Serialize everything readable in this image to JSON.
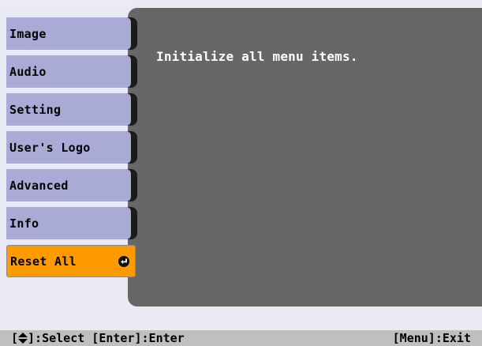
{
  "menu": {
    "items": [
      {
        "label": "Image",
        "active": false
      },
      {
        "label": "Audio",
        "active": false
      },
      {
        "label": "Setting",
        "active": false
      },
      {
        "label": "User's Logo",
        "active": false
      },
      {
        "label": "Advanced",
        "active": false
      },
      {
        "label": "Info",
        "active": false
      },
      {
        "label": "Reset All",
        "active": true,
        "icon": "enter-icon"
      }
    ]
  },
  "content": {
    "message": "Initialize all menu items."
  },
  "statusbar": {
    "left_prefix": "[",
    "left_icon": "up-down-arrow-icon",
    "left_suffix": "]:Select [Enter]:Enter",
    "right": "[Menu]:Exit"
  },
  "colors": {
    "menu_tab": "#a9aad6",
    "menu_active": "#ff9a00",
    "content_bg": "#676767",
    "background": "#eaeaf5",
    "statusbar_bg": "#bfbfbf"
  }
}
